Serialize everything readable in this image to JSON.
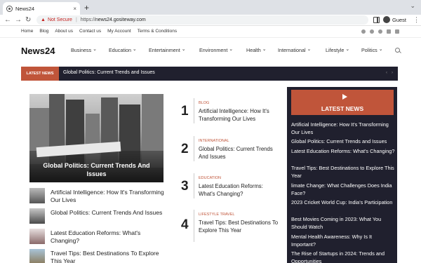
{
  "browser": {
    "tab_title": "News24",
    "tab_close": "×",
    "new_tab": "+",
    "not_secure": "Not Secure",
    "url_scheme": "https://",
    "url_host": "news24.gositeway.com",
    "profile": "Guest",
    "icons": [
      "favicon-icon",
      "back-icon",
      "forward-icon",
      "reload-icon",
      "warning-icon",
      "side-panel-icon",
      "profile-icon",
      "menu-icon"
    ]
  },
  "util_links": [
    "Home",
    "Blog",
    "About us",
    "Contact us",
    "My Account",
    "Terms & Conditions"
  ],
  "social_icons": [
    "facebook-icon",
    "twitter-icon",
    "instagram-icon",
    "linkedin-icon",
    "youtube-icon"
  ],
  "site": {
    "logo": "News24"
  },
  "nav": [
    "Business",
    "Education",
    "Entertainment",
    "Environment",
    "Health",
    "International",
    "Lifestyle",
    "Politics"
  ],
  "ticker": {
    "label": "LATEST NEWS",
    "text": "Global Politics: Current Trends and Issues"
  },
  "featured": {
    "title": "Global Politics: Current Trends And Issues"
  },
  "left_list": [
    "Artificial Intelligence: How It's Transforming Our Lives",
    "Global Politics: Current Trends And Issues",
    "Latest Education Reforms: What's Changing?",
    "Travel Tips: Best Destinations To Explore This Year"
  ],
  "numbered": [
    {
      "num": "1",
      "cat": "BLOG",
      "title": "Artificial Intelligence: How It's Transforming Our Lives"
    },
    {
      "num": "2",
      "cat": "INTERNATIONAL",
      "title": "Global Politics: Current Trends And Issues"
    },
    {
      "num": "3",
      "cat": "EDUCATION",
      "title": "Latest Education Reforms: What's Changing?"
    },
    {
      "num": "4",
      "cat": "LIFESTYLE TRAVEL",
      "title": "Travel Tips: Best Destinations To Explore This Year"
    }
  ],
  "latest_panel": {
    "title": "LATEST NEWS",
    "items": [
      "Artificial Intelligence: How It's Transforming Our Lives",
      "Global Politics: Current Trends and Issues",
      "Latest Education Reforms: What's Changing?",
      "Travel Tips: Best Destinations to Explore This Year",
      "limate Change: What Challenges Does India Face?",
      "2023 Cricket World Cup: India's Participation",
      "Best Movies Coming in 2023: What You Should Watch",
      "Mental Health Awareness: Why Is It Important?",
      " The Rise of Startups in 2024: Trends and Opportunities"
    ]
  },
  "colors": {
    "accent": "#c0553a",
    "dark": "#20202e"
  }
}
